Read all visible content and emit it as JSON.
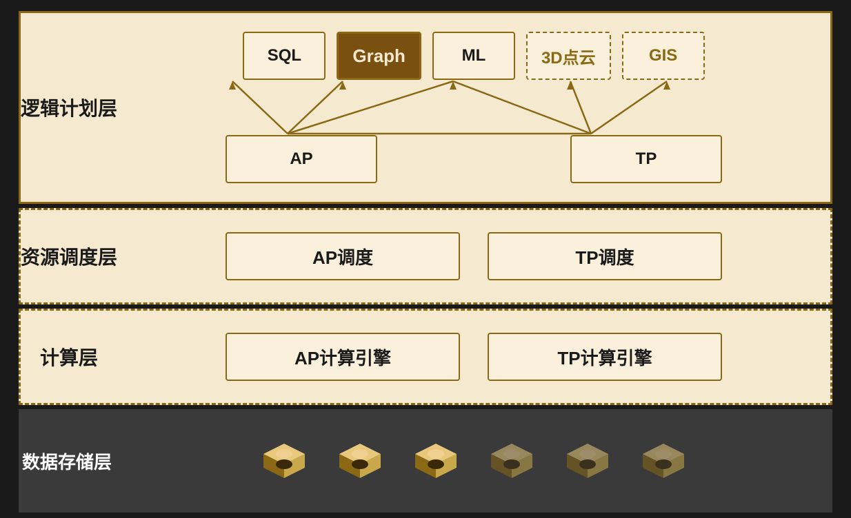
{
  "layers": {
    "logic": {
      "label": "逻辑计划层",
      "top_items": [
        {
          "id": "sql",
          "text": "SQL",
          "type": "normal"
        },
        {
          "id": "graph",
          "text": "Graph",
          "type": "highlight"
        },
        {
          "id": "ml",
          "text": "ML",
          "type": "normal"
        },
        {
          "id": "3d",
          "text": "3D点云",
          "type": "dashed"
        },
        {
          "id": "gis",
          "text": "GIS",
          "type": "dashed"
        }
      ],
      "bottom_items": [
        {
          "id": "ap",
          "text": "AP",
          "type": "normal"
        },
        {
          "id": "tp",
          "text": "TP",
          "type": "normal"
        }
      ]
    },
    "resource": {
      "label": "资源调度层",
      "items": [
        {
          "id": "ap-schedule",
          "text": "AP调度"
        },
        {
          "id": "tp-schedule",
          "text": "TP调度"
        }
      ]
    },
    "compute": {
      "label": "计算层",
      "items": [
        {
          "id": "ap-engine",
          "text": "AP计算引擎"
        },
        {
          "id": "tp-engine",
          "text": "TP计算引擎"
        }
      ]
    },
    "storage": {
      "label": "数据存储层",
      "icon_count_dark": 3,
      "icon_count_light": 3
    }
  },
  "colors": {
    "gold": "#8b6914",
    "box_bg": "#faf0dc",
    "layer_bg": "#f5ead0",
    "highlight_bg": "#7a5010",
    "highlight_text": "#f5ead0",
    "storage_bg": "#3a3a3a",
    "text_dark": "#1a1a1a",
    "text_gold": "#8b6914",
    "text_white": "#ffffff"
  }
}
